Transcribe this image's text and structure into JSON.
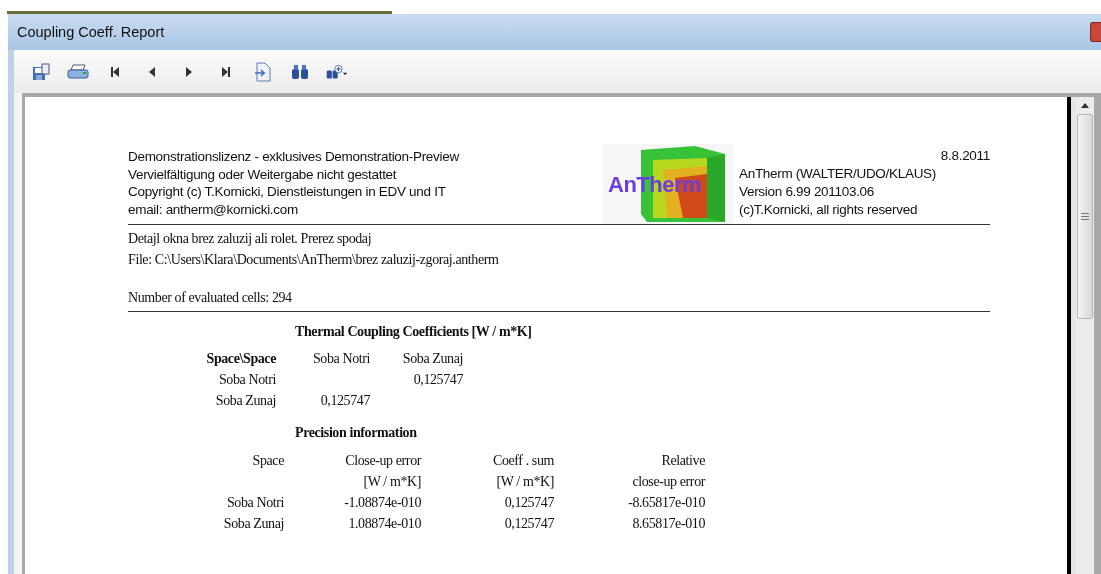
{
  "window": {
    "title": "Coupling Coeff. Report"
  },
  "toolbar": [
    {
      "kind": "save"
    },
    {
      "kind": "print"
    },
    {
      "kind": "first"
    },
    {
      "kind": "prev"
    },
    {
      "kind": "next"
    },
    {
      "kind": "last"
    },
    {
      "kind": "export"
    },
    {
      "kind": "find"
    },
    {
      "kind": "find-more"
    }
  ],
  "report": {
    "license_lines": [
      "Demonstrationslizenz - exklusives Demonstration-Preview",
      "Vervielfältigung oder Weitergabe nicht gestattet",
      "Copyright  (c) T.Kornicki, Dienstleistungen in EDV und IT",
      "email:  antherm@kornicki.com"
    ],
    "logo_text": "AnTherm",
    "date": "8.8.2011",
    "product_lines": [
      "AnTherm (WALTER/UDO/KLAUS)",
      "Version 6.99 201103.06",
      "(c)T.Kornicki, all rights reserved"
    ],
    "description_lines": [
      "Detajl okna brez zaluzij ali rolet. Prerez spodaj",
      "File: C:\\Users\\Klara\\Documents\\AnTherm\\brez zaluzij-zgoraj.antherm"
    ],
    "cells_line": "Number of evaluated cells: 294",
    "coupling": {
      "title": "Thermal Coupling Coefficients  [W / m*K]",
      "columns": [
        "Space\\Space",
        "Soba Notri",
        "Soba Zunaj"
      ],
      "rows": [
        [
          "Soba Notri",
          "",
          "0,125747"
        ],
        [
          "Soba Zunaj",
          "0,125747",
          ""
        ]
      ]
    },
    "precision": {
      "title": "Precision information",
      "header_rows": [
        [
          "Space",
          "Close-up error",
          "Coeff . sum",
          "Relative"
        ],
        [
          "",
          "[W / m*K]",
          "[W / m*K]",
          "close-up error"
        ]
      ],
      "rows": [
        [
          "Soba Notri",
          "-1.08874e-010",
          "0,125747",
          "-8.65817e-010"
        ],
        [
          "Soba Zunaj",
          "1.08874e-010",
          "0,125747",
          "8.65817e-010"
        ]
      ]
    }
  }
}
